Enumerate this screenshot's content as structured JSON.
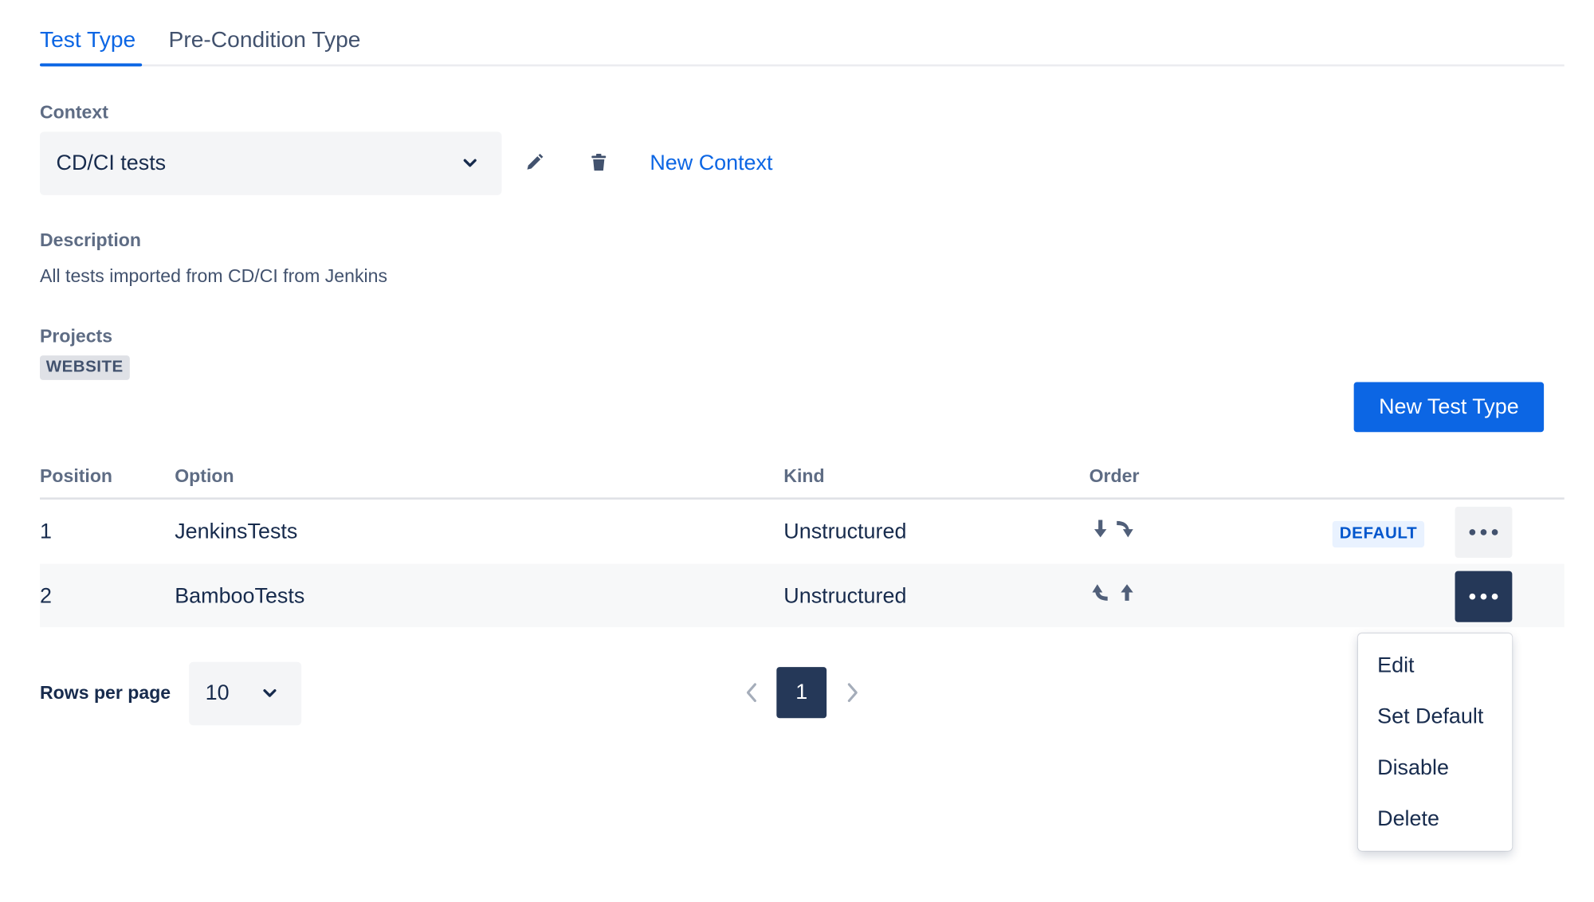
{
  "tabs": [
    {
      "label": "Test Type"
    },
    {
      "label": "Pre-Condition Type"
    }
  ],
  "context": {
    "label": "Context",
    "selected": "CD/CI tests",
    "new_context_label": "New Context"
  },
  "description": {
    "label": "Description",
    "text": "All tests imported from CD/CI from Jenkins"
  },
  "projects": {
    "label": "Projects",
    "items": [
      "WEBSITE"
    ]
  },
  "new_test_type_label": "New Test Type",
  "table": {
    "headers": {
      "position": "Position",
      "option": "Option",
      "kind": "Kind",
      "order": "Order"
    },
    "rows": [
      {
        "position": "1",
        "option": "JenkinsTests",
        "kind": "Unstructured",
        "badge": "DEFAULT"
      },
      {
        "position": "2",
        "option": "BambooTests",
        "kind": "Unstructured"
      }
    ]
  },
  "pagination": {
    "rows_per_page_label": "Rows per page",
    "rows_per_page_value": "10",
    "current_page": "1"
  },
  "actions_menu": {
    "items": [
      "Edit",
      "Set Default",
      "Disable",
      "Delete"
    ]
  },
  "colors": {
    "primary": "#0c66e4",
    "dark_button": "#253858",
    "text": "#172b4d",
    "subtle_text": "#5e6c84"
  }
}
